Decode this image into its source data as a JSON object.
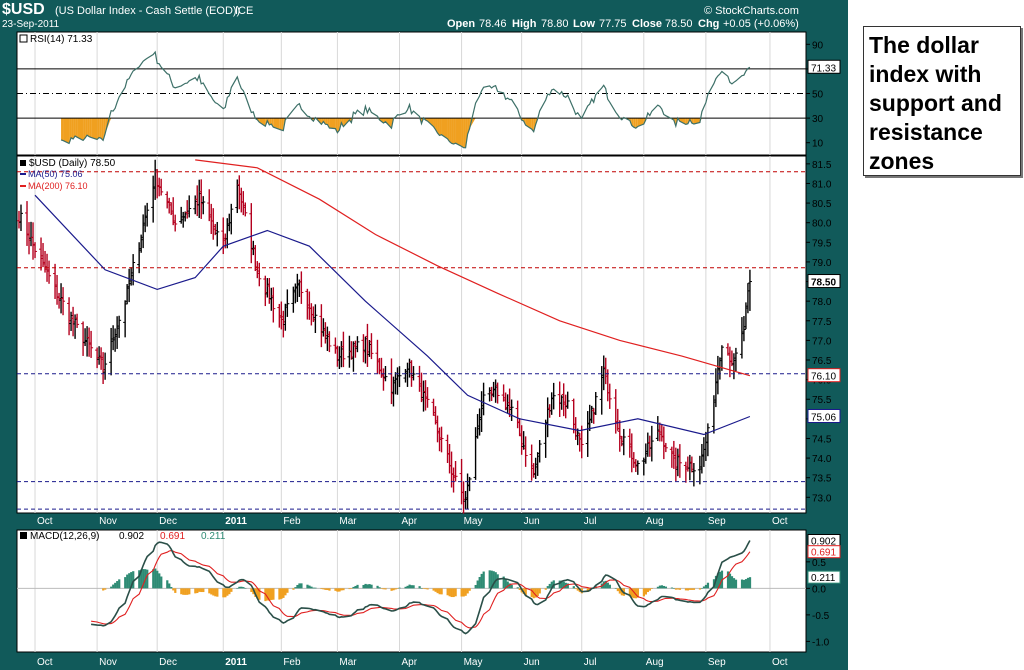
{
  "header": {
    "symbol": "$USD",
    "name": "(US Dollar Index - Cash Settle (EOD))",
    "exchange": "ICE",
    "date": "23-Sep-2011",
    "watermark": "© StockCharts.com",
    "open_label": "Open",
    "open": "78.46",
    "high_label": "High",
    "high": "78.80",
    "low_label": "Low",
    "low": "77.75",
    "close_label": "Close",
    "close": "78.50",
    "chg_label": "Chg",
    "chg": "+0.05 (+0.06%)"
  },
  "annotation": {
    "text": "The dollar index with support and resistance zones"
  },
  "colors": {
    "background": "#115a5a",
    "panel": "#ffffff",
    "up_bar": "#000000",
    "down_bar": "#b4001e",
    "ma50": "#1a1a8c",
    "ma200": "#e02020",
    "rsi_line": "#3d7068",
    "rsi_fill": "#f0a020",
    "macd_line": "#2a4f48",
    "signal_line": "#e02020",
    "histogram": "#2e8b74",
    "histogram_neg": "#f0a020"
  },
  "chart_data": [
    {
      "type": "line",
      "panel": "rsi",
      "legend": "RSI(14) 71.33",
      "ylim": [
        0,
        100
      ],
      "yticks": [
        "90",
        "70",
        "50",
        "30",
        "10"
      ],
      "reference_levels": [
        70,
        50,
        30
      ],
      "last_value_tag": "71.33",
      "x": [
        "2011-09-23"
      ],
      "series": [
        {
          "name": "RSI(14)",
          "values": [
            71.33
          ]
        }
      ]
    },
    {
      "type": "bar",
      "subtype": "ohlc",
      "panel": "price",
      "legend_price": "$USD (Daily) 78.50",
      "legend_ma50": "MA(50) 75.06",
      "legend_ma200": "MA(200) 76.10",
      "ylim": [
        72.6,
        81.7
      ],
      "yticks": [
        "81.5",
        "81.0",
        "80.5",
        "80.0",
        "79.5",
        "79.0",
        "78.5",
        "78.0",
        "77.5",
        "77.0",
        "76.5",
        "76.0",
        "75.5",
        "75.0",
        "74.5",
        "74.0",
        "73.5",
        "73.0"
      ],
      "price_tag": "78.50",
      "ma200_tag": "76.10",
      "ma50_tag": "75.06",
      "resistance_levels": [
        81.3,
        78.85
      ],
      "support_levels": [
        76.15,
        73.4,
        72.7
      ],
      "ohlc_last": {
        "date": "2011-09-23",
        "open": 78.46,
        "high": 78.8,
        "low": 77.75,
        "close": 78.5
      },
      "series": [
        {
          "name": "MA(50)",
          "x": [
            "2010-10-01",
            "2010-11-05",
            "2010-12-01",
            "2010-12-20",
            "2011-01-03",
            "2011-01-25",
            "2011-02-15",
            "2011-03-15",
            "2011-04-15",
            "2011-05-05",
            "2011-05-31",
            "2011-06-30",
            "2011-07-29",
            "2011-08-31",
            "2011-09-23"
          ],
          "values": [
            80.7,
            78.8,
            78.3,
            78.6,
            79.4,
            79.8,
            79.4,
            78.0,
            76.6,
            75.6,
            75.0,
            74.7,
            75.0,
            74.6,
            75.06
          ]
        },
        {
          "name": "MA(200)",
          "x": [
            "2010-12-20",
            "2011-01-20",
            "2011-02-20",
            "2011-03-20",
            "2011-04-20",
            "2011-05-20",
            "2011-06-20",
            "2011-07-20",
            "2011-08-20",
            "2011-09-23"
          ],
          "values": [
            81.6,
            81.4,
            80.6,
            79.7,
            78.9,
            78.2,
            77.5,
            77.0,
            76.6,
            76.1
          ]
        }
      ]
    },
    {
      "type": "line",
      "panel": "macd",
      "legend_label": "MACD(12,26,9)",
      "legend_values": [
        "0.902",
        "0.691",
        "0.211"
      ],
      "ylim": [
        -1.2,
        1.1
      ],
      "yticks": [
        "0.5",
        "0.0",
        "-0.5",
        "-1.0"
      ],
      "value_tags": [
        "0.902",
        "0.691",
        "0.211"
      ],
      "x": [
        "2011-09-23"
      ],
      "series": [
        {
          "name": "MACD",
          "values": [
            0.902
          ]
        },
        {
          "name": "Signal",
          "values": [
            0.691
          ]
        },
        {
          "name": "Histogram",
          "values": [
            0.211
          ]
        }
      ]
    },
    {
      "type": "axis",
      "panel": "time",
      "x_labels": [
        "Oct",
        "Nov",
        "Dec",
        "2011",
        "Feb",
        "Mar",
        "Apr",
        "May",
        "Jun",
        "Jul",
        "Aug",
        "Sep",
        "Oct"
      ]
    }
  ]
}
